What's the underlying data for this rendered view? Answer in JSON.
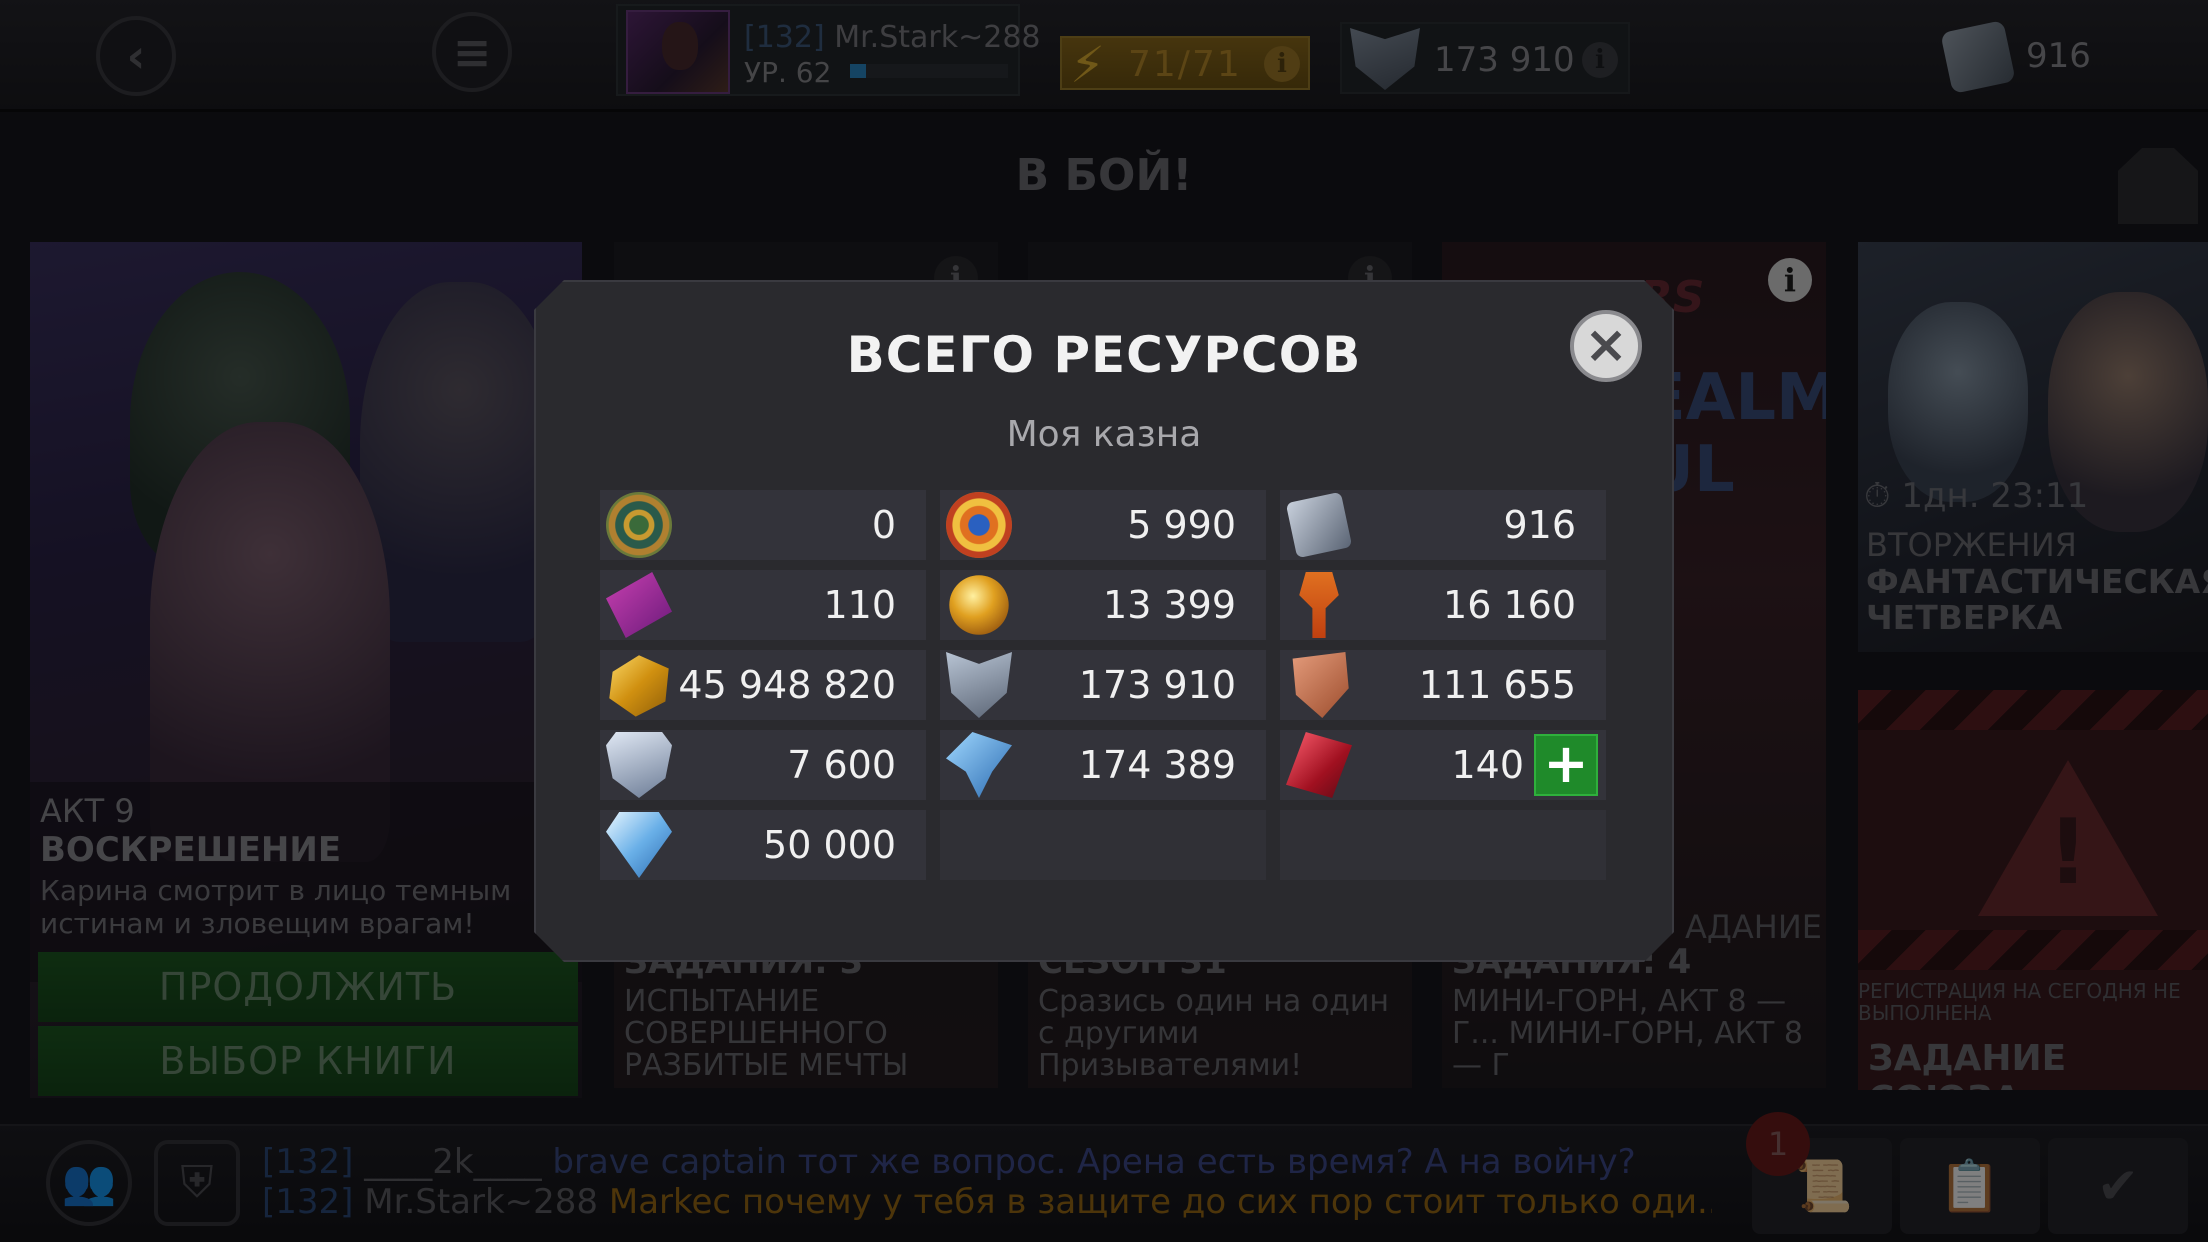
{
  "topbar": {
    "player_tag": "[132]",
    "player_name": "Mr.Stark~288",
    "player_level": "УР. 62",
    "player_xp_fraction": 0.1,
    "energy": "71/71",
    "gold": "173 910",
    "units": "916",
    "icons": {
      "back": "back-arrow-icon",
      "menu": "menu-icon",
      "energy": "lightning-icon",
      "info": "info-icon",
      "gold": "gold-shield-icon",
      "units": "units-icon"
    }
  },
  "background": {
    "title": "В БОЙ!",
    "story": {
      "act": "АКТ 9",
      "title": "ВОСКРЕШЕНИЕ",
      "description": "Карина смотрит в лицо темным истинам и зловещим врагам!",
      "continue_label": "ПРОДОЛЖИТЬ",
      "book_label": "ВЫБОР КНИГИ"
    },
    "card1": {
      "head": "ЗАДАНИЯ: 3",
      "text": "ИСПЫТАНИЕ СОВЕРШЕННОГО РАЗБИТЫЕ МЕЧТЫ"
    },
    "card2": {
      "head": "СЕЗОН 31",
      "text": "Сразись один на один с другими Призывателями!"
    },
    "card3": {
      "logo": "NERS",
      "art": "EALM UL",
      "head_a": "АДАНИЕ",
      "head": "ЗАДАНИЯ: 4",
      "text": "МИНИ-ГОРН, АКТ 8 — Г... МИНИ-ГОРН, АКТ 8 — Г"
    },
    "invasion": {
      "timer": "1дн. 23:11",
      "label": "ВТОРЖЕНИЯ",
      "title": "ФАНТАСТИЧЕСКАЯ ЧЕТВЕРКА"
    },
    "alliance_quest": {
      "registration": "РЕГИСТРАЦИЯ НА СЕГОДНЯ НЕ ВЫПОЛНЕНА",
      "title": "ЗАДАНИЕ СОЮЗА"
    }
  },
  "bottombar": {
    "chat": [
      {
        "tag": "[132]",
        "user": "____2k____",
        "user2": "brave captain",
        "message": "тот же вопрос. Арена есть время? А на войну?"
      },
      {
        "tag": "[132]",
        "user": "Mr.Stark~288",
        "user2": "Markec",
        "message": "почему у тебя в защите до сих пор стоит только оди..."
      }
    ],
    "notification_count": "1",
    "icons": {
      "friends": "friends-icon",
      "alliance": "alliance-shield-icon",
      "tool1": "quest-scroll-icon",
      "tool2": "notes-icon",
      "tool3": "checkmark-icon"
    }
  },
  "modal": {
    "title": "ВСЕГО РЕСУРСОВ",
    "subtitle": "Моя казна",
    "close_icon": "close-icon",
    "resources": [
      {
        "icon": "unit-coin-icon",
        "value": "0"
      },
      {
        "icon": "glory-icon",
        "value": "5 990"
      },
      {
        "icon": "units-icon",
        "value": "916"
      },
      {
        "icon": "ticket-icon",
        "value": "110"
      },
      {
        "icon": "amber-orb-icon",
        "value": "13 399"
      },
      {
        "icon": "quest-token-icon",
        "value": "16 160"
      },
      {
        "icon": "gold-icon",
        "value": "45 948 820"
      },
      {
        "icon": "battlechip-icon",
        "value": "173 910"
      },
      {
        "icon": "bronze-badge-icon",
        "value": "111 655"
      },
      {
        "icon": "loyalty-shield-icon",
        "value": "7 600"
      },
      {
        "icon": "crystal-shard-icon",
        "value": "174 389"
      },
      {
        "icon": "red-crystal-icon",
        "value": "140"
      },
      {
        "icon": "diamond-icon",
        "value": "50 000"
      }
    ],
    "add_label": "+"
  }
}
